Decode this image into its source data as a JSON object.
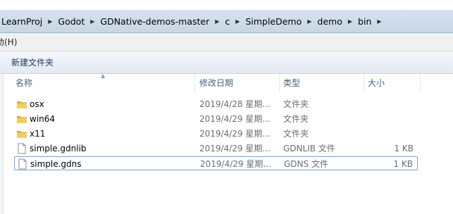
{
  "breadcrumb": [
    "LearnProj",
    "Godot",
    "GDNative-demos-master",
    "c",
    "SimpleDemo",
    "demo",
    "bin"
  ],
  "menu": {
    "help": "助(H)"
  },
  "toolbar": {
    "new_folder": "新建文件夹"
  },
  "columns": {
    "name": "名称",
    "date": "修改日期",
    "type": "类型",
    "size": "大小"
  },
  "files": [
    {
      "name": "osx",
      "date": "2019/4/28 星期...",
      "type": "文件夹",
      "size": "",
      "icon": "folder-icon"
    },
    {
      "name": "win64",
      "date": "2019/4/29 星期...",
      "type": "文件夹",
      "size": "",
      "icon": "folder-icon"
    },
    {
      "name": "x11",
      "date": "2019/4/29 星期...",
      "type": "文件夹",
      "size": "",
      "icon": "folder-icon"
    },
    {
      "name": "simple.gdnlib",
      "date": "2019/4/29 星期...",
      "type": "GDNLIB 文件",
      "size": "1 KB",
      "icon": "file-icon"
    },
    {
      "name": "simple.gdns",
      "date": "2019/4/29 星期...",
      "type": "GDNS 文件",
      "size": "1 KB",
      "icon": "file-icon"
    }
  ],
  "colors": {
    "folder": "#e8c25a",
    "focus_border": "#7da2ce",
    "header_text": "#4c607a"
  }
}
